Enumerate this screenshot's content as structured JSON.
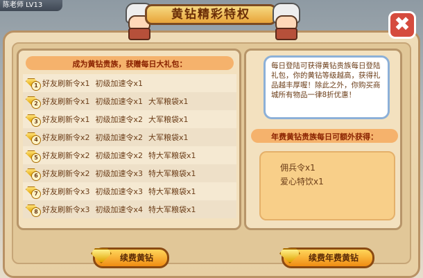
{
  "top_badge": "陈老师   LV13",
  "title": "黄钻精彩特权",
  "list_header": "成为黄钻贵族，获赠每日大礼包：",
  "rows": [
    {
      "level": "1",
      "items": [
        "好友刷新令x1",
        "初级加速令x1"
      ]
    },
    {
      "level": "2",
      "items": [
        "好友刷新令x1",
        "初级加速令x1",
        "大军粮袋x1"
      ]
    },
    {
      "level": "3",
      "items": [
        "好友刷新令x1",
        "初级加速令x2",
        "大军粮袋x1"
      ]
    },
    {
      "level": "4",
      "items": [
        "好友刷新令x2",
        "初级加速令x2",
        "大军粮袋x1"
      ]
    },
    {
      "level": "5",
      "items": [
        "好友刷新令x2",
        "初级加速令x2",
        "特大军粮袋x1"
      ]
    },
    {
      "level": "6",
      "items": [
        "好友刷新令x2",
        "初级加速令x3",
        "特大军粮袋x1"
      ]
    },
    {
      "level": "7",
      "items": [
        "好友刷新令x3",
        "初级加速令x3",
        "特大军粮袋x1"
      ]
    },
    {
      "level": "8",
      "items": [
        "好友刷新令x3",
        "初级加速令x4",
        "特大军粮袋x1"
      ]
    }
  ],
  "info_text": "每日登陆可获得黄钻贵族每日登陆礼包，你的黄钻等级越高，获得礼品越丰厚喔！除此之外，你购买商城所有物品一律8折优惠！",
  "extra_header": "年费黄钻贵族每日可额外获得：",
  "extra_items": [
    "佣兵令x1",
    "爱心特饮x1"
  ],
  "buttons": {
    "renew": "续费黄钻",
    "renew_year": "续费年费黄钻"
  },
  "close_symbol": "✖"
}
